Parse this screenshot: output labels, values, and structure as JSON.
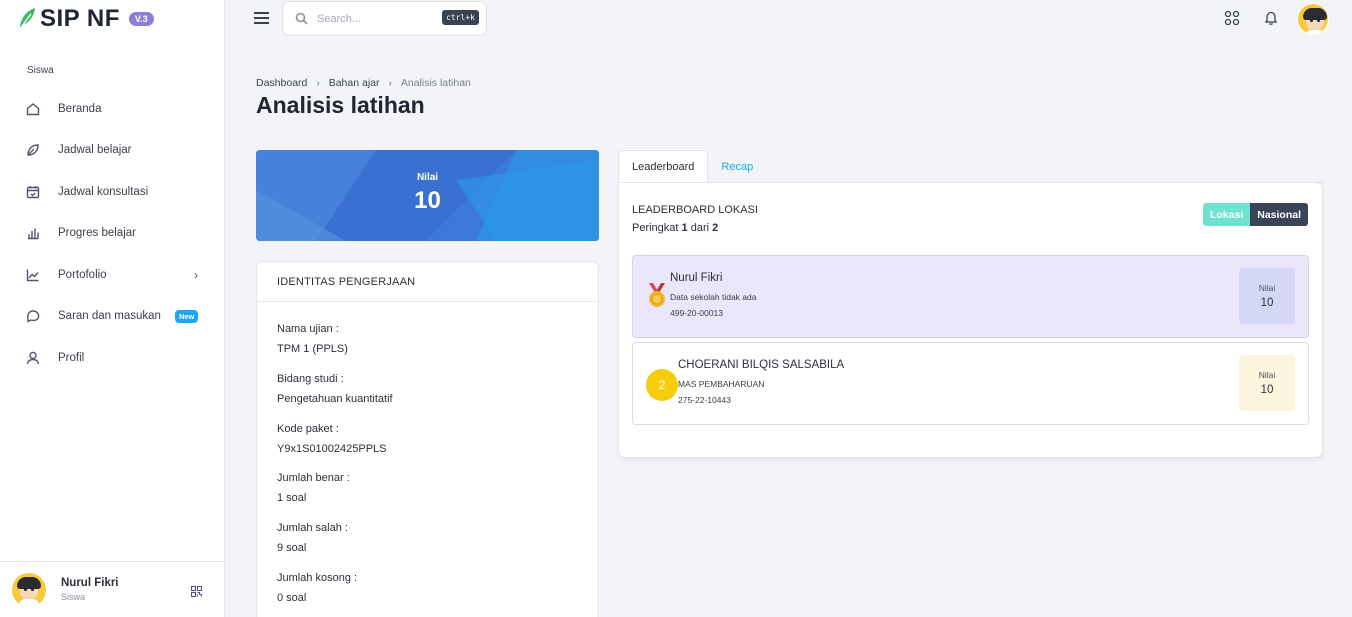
{
  "app": {
    "name": "SIP NF",
    "version": "V.3"
  },
  "sidebar": {
    "section": "Siswa",
    "items": [
      {
        "label": "Beranda",
        "icon": "home-icon"
      },
      {
        "label": "Jadwal belajar",
        "icon": "leaf-icon"
      },
      {
        "label": "Jadwal konsultasi",
        "icon": "calendar-check-icon"
      },
      {
        "label": "Progres belajar",
        "icon": "bar-chart-icon"
      },
      {
        "label": "Portofolio",
        "icon": "line-chart-icon"
      },
      {
        "label": "Saran dan masukan",
        "icon": "chat-icon",
        "badge": "New"
      },
      {
        "label": "Profil",
        "icon": "user-icon"
      }
    ],
    "user": {
      "name": "Nurul Fikri",
      "role": "Siswa"
    }
  },
  "topbar": {
    "search_placeholder": "Search...",
    "shortcut": "ctrl+k"
  },
  "breadcrumb": [
    "Dashboard",
    "Bahan ajar",
    "Analisis latihan"
  ],
  "page_title": "Analisis latihan",
  "score": {
    "label": "Nilai",
    "value": "10"
  },
  "identity": {
    "title": "IDENTITAS PENGERJAAN",
    "fields": [
      {
        "key": "Nama ujian :",
        "value": "TPM 1 (PPLS)"
      },
      {
        "key": "Bidang studi :",
        "value": "Pengetahuan kuantitatif"
      },
      {
        "key": "Kode paket :",
        "value": "Y9x1S01002425PPLS"
      },
      {
        "key": "Jumlah benar :",
        "value": "1 soal"
      },
      {
        "key": "Jumlah salah :",
        "value": "9 soal"
      },
      {
        "key": "Jumlah kosong :",
        "value": "0 soal"
      }
    ]
  },
  "tabs": [
    {
      "label": "Leaderboard",
      "active": true
    },
    {
      "label": "Recap",
      "active": false
    }
  ],
  "leaderboard": {
    "title": "LEADERBOARD LOKASI",
    "rank_prefix": "Peringkat",
    "rank": "1",
    "rank_mid": "dari",
    "total": "2",
    "toggle": {
      "lokasi": "Lokasi",
      "nasional": "Nasional"
    },
    "entries": [
      {
        "rank": "1",
        "name": "Nurul Fikri",
        "school": "Data sekolah tidak ada",
        "id": "499-20-00013",
        "score_label": "Nilai",
        "score": "10"
      },
      {
        "rank": "2",
        "name": "CHOERANI BILQIS SALSABILA",
        "school": "MAS PEMBAHARUAN",
        "id": "275-22-10443",
        "score_label": "Nilai",
        "score": "10"
      }
    ]
  },
  "colors": {
    "accent": "#3b7ad6",
    "link": "#1ea7e6",
    "medal": "#f7cc0c",
    "toggle_active": "#6fe3cf",
    "toggle_dark": "#3a4458"
  }
}
